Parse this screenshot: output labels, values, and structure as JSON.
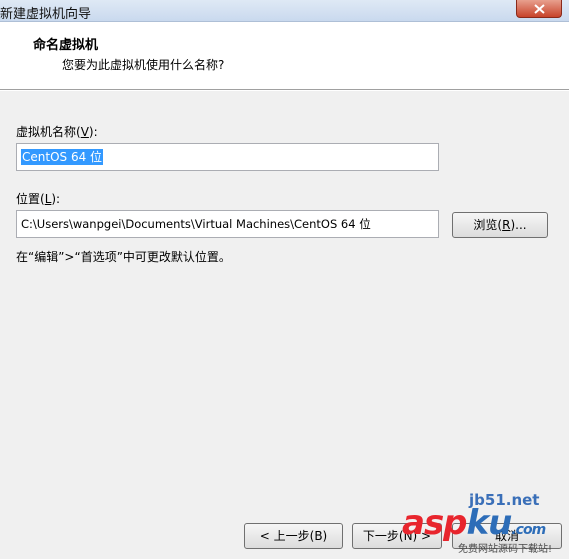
{
  "window": {
    "title": "新建虚拟机向导"
  },
  "header": {
    "title": "命名虚拟机",
    "subtitle": "您要为此虚拟机使用什么名称?"
  },
  "form": {
    "name_label_prefix": "虚拟机名称(",
    "name_label_key": "V",
    "name_label_suffix": "):",
    "name_value": "CentOS 64 位",
    "location_label_prefix": "位置(",
    "location_label_key": "L",
    "location_label_suffix": "):",
    "location_value": "C:\\Users\\wanpgei\\Documents\\Virtual Machines\\CentOS 64 位",
    "browse_prefix": "浏览(",
    "browse_key": "R",
    "browse_suffix": ")...",
    "hint": "在“编辑”>“首选项”中可更改默认位置。"
  },
  "footer": {
    "back_label": "< 上一步(B)",
    "next_label": "下一步(N) >",
    "cancel_label": "取消"
  },
  "watermark": {
    "site": "jb51.net",
    "logo_a": "asp",
    "logo_b": "ku",
    "logo_c": ".com",
    "slogan": "免费网站源码下载站!"
  },
  "colors": {
    "selection": "#3399ff",
    "dialog_bg": "#f0f0f0"
  }
}
